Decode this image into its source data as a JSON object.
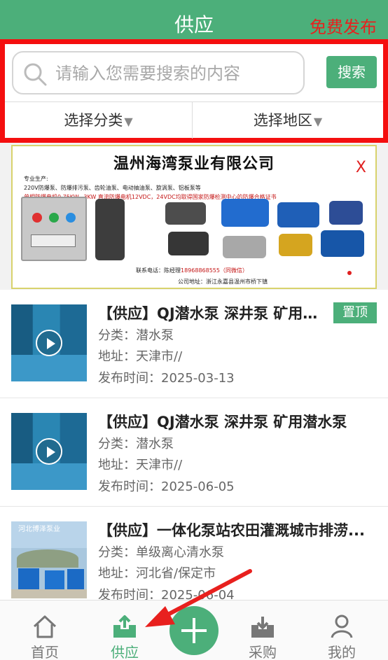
{
  "header": {
    "title": "供应",
    "action_label": "免费发布"
  },
  "search": {
    "placeholder": "请输入您需要搜索的内容",
    "value": "",
    "button_label": "搜索",
    "category_filter": "选择分类",
    "region_filter": "选择地区"
  },
  "banner": {
    "title": "温州海湾泵业有限公司",
    "close": "X",
    "lines": [
      "专业生产:",
      "220V防爆泵、防爆排污泵、齿轮油泵、电动抽油泵、旋涡泵、铝板泵等",
      "单相防爆电机0.75KW~3KW 直流防爆电机12VDC，24VDC均取得国家防爆检测中心的防爆合格证书"
    ],
    "contact_prefix": "联系电话：陈经理",
    "phone": "18968868555（同微信）",
    "address": "公司地址：浙江永嘉县温州市桥下镇"
  },
  "listings": [
    {
      "title": "【供应】QJ潜水泵 深井泵 矿用潜水泵",
      "category": "分类：潜水泵",
      "location": "地址：天津市//",
      "date": "发布时间：2025-03-13",
      "badge": "置顶",
      "has_video": true
    },
    {
      "title": "【供应】QJ潜水泵 深井泵 矿用潜水泵",
      "category": "分类：潜水泵",
      "location": "地址：天津市//",
      "date": "发布时间：2025-06-05",
      "has_video": true
    },
    {
      "title": "【供应】一体化泵站农田灌溉城市排涝...",
      "category": "分类：单级离心清水泵",
      "location": "地址：河北省/保定市",
      "date": "发布时间：2025-06-04",
      "thumb_caption": "河北博泽泵业",
      "has_video": false
    }
  ],
  "tabs": [
    {
      "label": "首页",
      "icon": "home-icon",
      "active": false
    },
    {
      "label": "供应",
      "icon": "supply-icon",
      "active": true
    },
    {
      "label": "采购",
      "icon": "purchase-icon",
      "active": false
    },
    {
      "label": "我的",
      "icon": "profile-icon",
      "active": false
    }
  ],
  "colors": {
    "accent": "#4caf7a",
    "annotation": "#e8201e"
  }
}
